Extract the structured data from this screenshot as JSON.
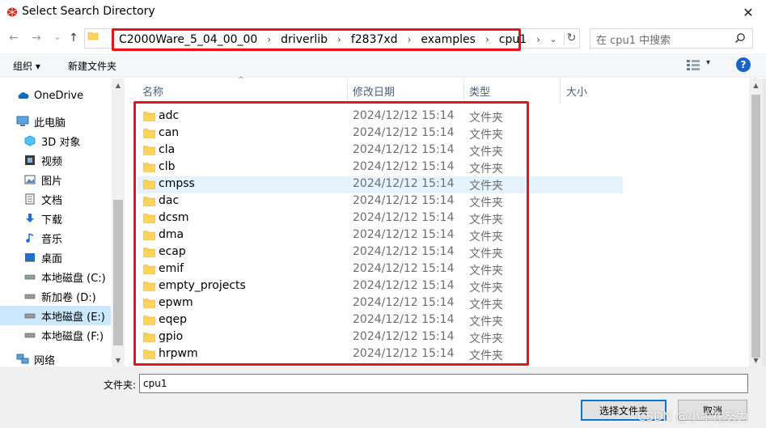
{
  "window": {
    "title": "Select Search Directory",
    "close_glyph": "✕"
  },
  "nav": {
    "back": "←",
    "forward": "→",
    "recent": "⌄",
    "up": "↑"
  },
  "address": {
    "crumbs": [
      "C2000Ware_5_04_00_00",
      "driverlib",
      "f2837xd",
      "examples",
      "cpu1"
    ],
    "separator": "›",
    "dropdown_glyph": "⌄",
    "refresh_glyph": "↻"
  },
  "search": {
    "placeholder": "在 cpu1 中搜索"
  },
  "toolbar": {
    "organize": "组织 ▾",
    "new_folder": "新建文件夹",
    "view_dropdown": "▾",
    "help": "?"
  },
  "sidebar": {
    "items": [
      {
        "label": "OneDrive",
        "icon": "cloud-icon"
      },
      {
        "label": "此电脑",
        "icon": "computer-icon"
      },
      {
        "label": "3D 对象",
        "icon": "cube-icon"
      },
      {
        "label": "视频",
        "icon": "video-icon"
      },
      {
        "label": "图片",
        "icon": "picture-icon"
      },
      {
        "label": "文档",
        "icon": "document-icon"
      },
      {
        "label": "下载",
        "icon": "download-icon"
      },
      {
        "label": "音乐",
        "icon": "music-icon"
      },
      {
        "label": "桌面",
        "icon": "desktop-icon"
      },
      {
        "label": "本地磁盘 (C:)",
        "icon": "drive-icon"
      },
      {
        "label": "新加卷 (D:)",
        "icon": "drive-icon"
      },
      {
        "label": "本地磁盘 (E:)",
        "icon": "drive-icon",
        "selected": true
      },
      {
        "label": "本地磁盘 (F:)",
        "icon": "drive-icon"
      },
      {
        "label": "网络",
        "icon": "network-icon"
      }
    ]
  },
  "columns": {
    "name": "名称",
    "date": "修改日期",
    "type": "类型",
    "size": "大小",
    "sort_glyph": "^"
  },
  "files": [
    {
      "name": "adc",
      "date": "2024/12/12 15:14",
      "type": "文件夹"
    },
    {
      "name": "can",
      "date": "2024/12/12 15:14",
      "type": "文件夹"
    },
    {
      "name": "cla",
      "date": "2024/12/12 15:14",
      "type": "文件夹"
    },
    {
      "name": "clb",
      "date": "2024/12/12 15:14",
      "type": "文件夹"
    },
    {
      "name": "cmpss",
      "date": "2024/12/12 15:14",
      "type": "文件夹",
      "hover": true
    },
    {
      "name": "dac",
      "date": "2024/12/12 15:14",
      "type": "文件夹"
    },
    {
      "name": "dcsm",
      "date": "2024/12/12 15:14",
      "type": "文件夹"
    },
    {
      "name": "dma",
      "date": "2024/12/12 15:14",
      "type": "文件夹"
    },
    {
      "name": "ecap",
      "date": "2024/12/12 15:14",
      "type": "文件夹"
    },
    {
      "name": "emif",
      "date": "2024/12/12 15:14",
      "type": "文件夹"
    },
    {
      "name": "empty_projects",
      "date": "2024/12/12 15:14",
      "type": "文件夹"
    },
    {
      "name": "epwm",
      "date": "2024/12/12 15:14",
      "type": "文件夹"
    },
    {
      "name": "eqep",
      "date": "2024/12/12 15:14",
      "type": "文件夹"
    },
    {
      "name": "gpio",
      "date": "2024/12/12 15:14",
      "type": "文件夹"
    },
    {
      "name": "hrpwm",
      "date": "2024/12/12 15:14",
      "type": "文件夹"
    }
  ],
  "footer": {
    "folder_label": "文件夹:",
    "folder_value": "cpu1",
    "select_button": "选择文件夹",
    "cancel_button": "取消",
    "watermark": "CSDN @小牛在努力"
  },
  "colors": {
    "highlight_red": "#e8141c",
    "selection_blue": "#cce8ff",
    "hover_blue": "#e5f3ff",
    "folder_yellow": "#ffd35c",
    "accent": "#0078d7"
  }
}
